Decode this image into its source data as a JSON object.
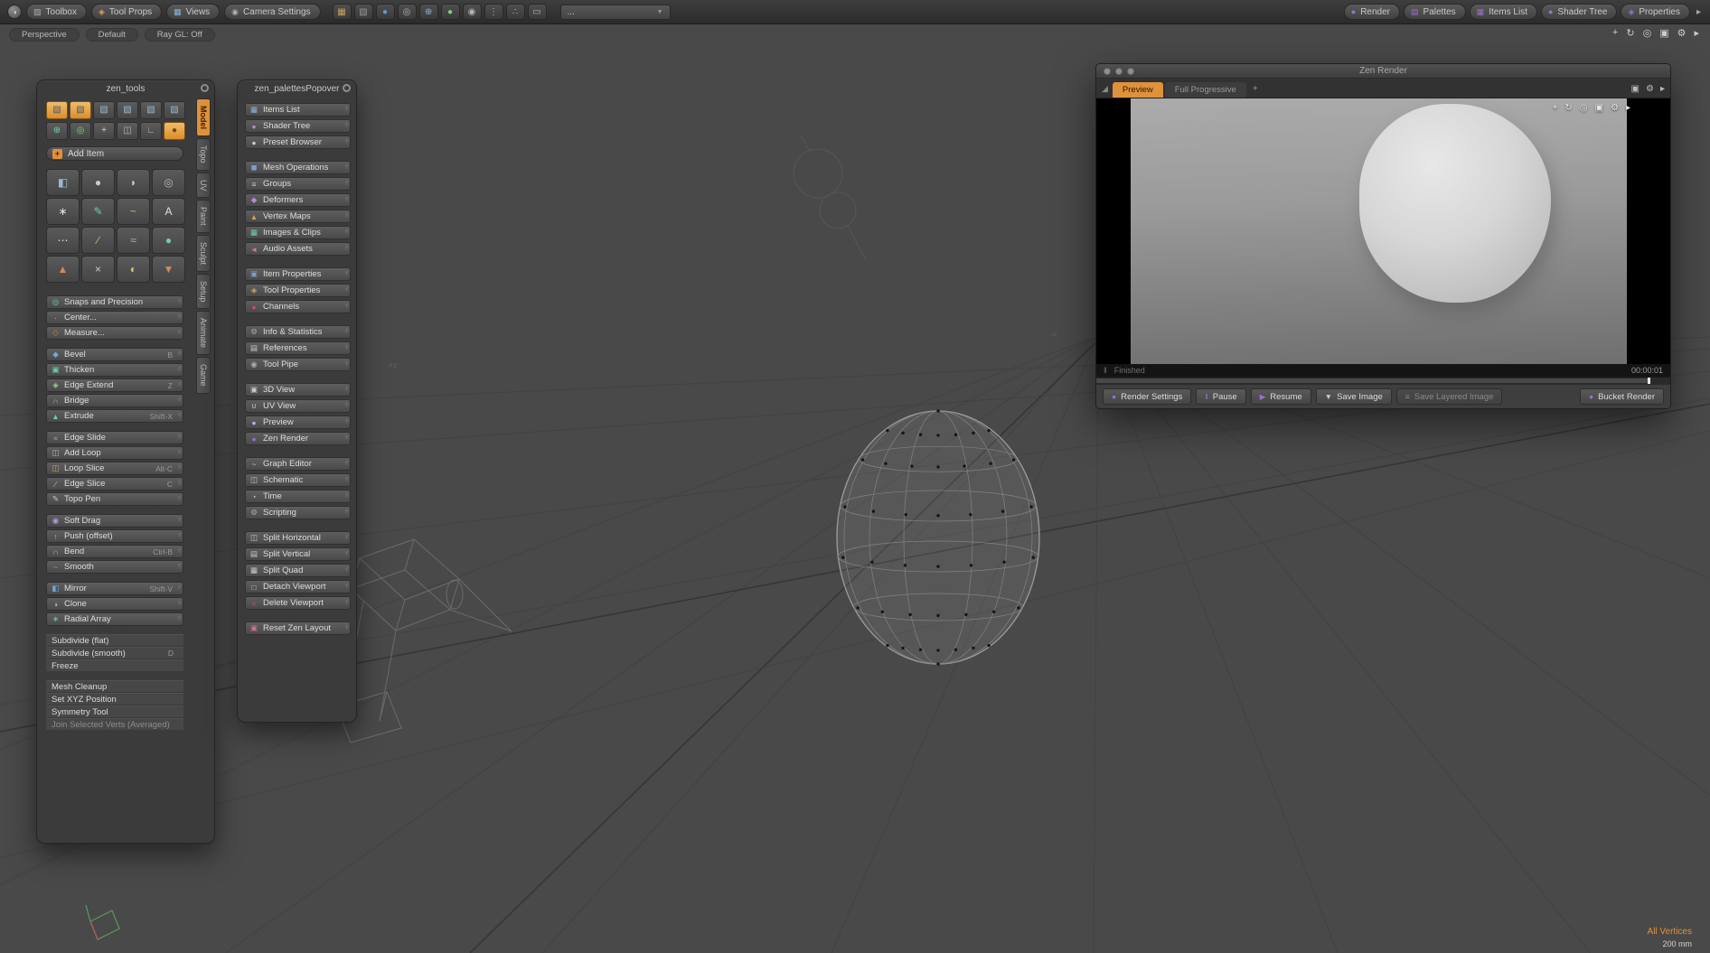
{
  "colors": {
    "accent_orange": "#e0913c",
    "accent_purple": "#9a6fd0"
  },
  "top_toolbar": {
    "left_buttons": [
      {
        "label": "Toolbox",
        "icon": "toolbox-icon",
        "glyph": "▨",
        "icon_color": "#b0b0b0"
      },
      {
        "label": "Tool Props",
        "icon": "tool-props-icon",
        "glyph": "◈",
        "icon_color": "#d4a15a"
      },
      {
        "label": "Views",
        "icon": "views-icon",
        "glyph": "▦",
        "icon_color": "#8ab4d8"
      },
      {
        "label": "Camera Settings",
        "icon": "camera-settings-icon",
        "glyph": "◉",
        "icon_color": "#b0b0b0"
      }
    ],
    "icon_cluster": [
      {
        "icon": "selection-presets-icon",
        "glyph": "▦",
        "icon_color": "#c9a15a"
      },
      {
        "icon": "workplane-icon",
        "glyph": "▧",
        "icon_color": "#9a9a9a"
      },
      {
        "icon": "snapping-icon",
        "glyph": "●",
        "icon_color": "#5a9ad4"
      },
      {
        "icon": "falloff-icon",
        "glyph": "◎",
        "icon_color": "#b8b8b8"
      },
      {
        "icon": "action-center-icon",
        "glyph": "⊕",
        "icon_color": "#8ab4d8"
      },
      {
        "icon": "symmetry-icon",
        "glyph": "●",
        "icon_color": "#7ad47a"
      },
      {
        "icon": "tool-handles-icon",
        "glyph": "◉",
        "icon_color": "#b8b8b8"
      },
      {
        "icon": "item-tree-icon",
        "glyph": "⋮",
        "icon_color": "#8fd47a"
      },
      {
        "icon": "schematic-nodes-icon",
        "glyph": "∴",
        "icon_color": "#b8b8b8"
      },
      {
        "icon": "slider-ribbon-icon",
        "glyph": "▭",
        "icon_color": "#b8b8b8"
      }
    ],
    "dropdown_value": "...",
    "dropdown_arrow": "▼",
    "right_buttons": [
      {
        "label": "Render",
        "icon": "render-icon",
        "glyph": "●",
        "icon_color": "#9a6fd0"
      },
      {
        "label": "Palettes",
        "icon": "palettes-icon",
        "glyph": "▤",
        "icon_color": "#9a6fd0"
      },
      {
        "label": "Items List",
        "icon": "items-list-icon",
        "glyph": "▦",
        "icon_color": "#9a6fd0"
      },
      {
        "label": "Shader Tree",
        "icon": "shader-tree-icon",
        "glyph": "●",
        "icon_color": "#9a6fd0"
      },
      {
        "label": "Properties",
        "icon": "properties-icon",
        "glyph": "◈",
        "icon_color": "#9a6fd0"
      }
    ],
    "expand_arrow": "▸"
  },
  "view_bar": {
    "pills": [
      {
        "label": "Perspective",
        "name": "view-type-button"
      },
      {
        "label": "Default",
        "name": "view-style-button"
      },
      {
        "label": "Ray GL: Off",
        "name": "ray-gl-button"
      }
    ],
    "icons": [
      {
        "icon": "pan-view-icon",
        "glyph": "+"
      },
      {
        "icon": "orbit-view-icon",
        "glyph": "↻"
      },
      {
        "icon": "zoom-view-icon",
        "glyph": "◎"
      },
      {
        "icon": "fit-view-icon",
        "glyph": "▣"
      },
      {
        "icon": "viewport-options-icon",
        "glyph": "⚙"
      },
      {
        "icon": "viewport-expand-icon",
        "glyph": "▸"
      }
    ]
  },
  "zen_tools": {
    "title": "zen_tools",
    "add_item_label": "Add Item",
    "mode_buttons_top": [
      {
        "icon": "vertices-mode-icon",
        "glyph": "▧",
        "icon_color": "#41586e",
        "cls": "active"
      },
      {
        "icon": "edges-mode-icon",
        "glyph": "▧",
        "icon_color": "#41586e",
        "cls": "active"
      },
      {
        "icon": "polygons-mode-icon",
        "glyph": "▧",
        "icon_color": "#9ab8d0"
      },
      {
        "icon": "items-mode-icon",
        "glyph": "▧",
        "icon_color": "#9ab8d0"
      },
      {
        "icon": "center-mode-icon",
        "glyph": "▧",
        "icon_color": "#9ab8d0"
      },
      {
        "icon": "pivot-mode-icon",
        "glyph": "▧",
        "icon_color": "#9ab8d0"
      }
    ],
    "mode_buttons_bottom": [
      {
        "icon": "axis-mode-icon",
        "glyph": "⊕",
        "icon_color": "#6ec9b8"
      },
      {
        "icon": "radial-falloff-icon",
        "glyph": "◎",
        "icon_color": "#7ad47a"
      },
      {
        "icon": "add-mode-icon",
        "glyph": "+",
        "icon_color": "#d0d0d0"
      },
      {
        "icon": "split-view-icon",
        "glyph": "◫",
        "icon_color": "#b8b8b8"
      },
      {
        "icon": "corner-align-icon",
        "glyph": "∟",
        "icon_color": "#b8b8b8"
      },
      {
        "icon": "ghost-mode-icon",
        "glyph": "●",
        "icon_color": "#6a4a10",
        "cls": "active"
      }
    ],
    "tabs": [
      {
        "label": "Model",
        "cls": "active"
      },
      {
        "label": "Topo"
      },
      {
        "label": "UV"
      },
      {
        "label": "Paint"
      },
      {
        "label": "Sculpt"
      },
      {
        "label": "Setup"
      },
      {
        "label": "Animate"
      },
      {
        "label": "Game"
      }
    ],
    "tool_grid": [
      {
        "icon": "cube-tool-icon",
        "glyph": "◧",
        "icon_color": "#9ab8d0"
      },
      {
        "icon": "sphere-tool-icon",
        "glyph": "●",
        "icon_color": "#c9c9c9"
      },
      {
        "icon": "capsule-tool-icon",
        "glyph": "◗",
        "icon_color": "#c9c9c9"
      },
      {
        "icon": "toroid-tool-icon",
        "glyph": "◎",
        "icon_color": "#b8b8b8"
      },
      {
        "icon": "star-tool-icon",
        "glyph": "∗",
        "icon_color": "#e0e0e0"
      },
      {
        "icon": "pen-tool-icon",
        "glyph": "✎",
        "icon_color": "#6ec9b8"
      },
      {
        "icon": "curve-tool-icon",
        "glyph": "~",
        "icon_color": "#8fd47a"
      },
      {
        "icon": "text-tool-icon",
        "glyph": "A",
        "icon_color": "#e0e0e0"
      },
      {
        "icon": "bezier-tool-icon",
        "glyph": "⋯",
        "icon_color": "#e0e0e0"
      },
      {
        "icon": "line-tool-icon",
        "glyph": "∕",
        "icon_color": "#8fd47a"
      },
      {
        "icon": "sketch-tool-icon",
        "glyph": "≈",
        "icon_color": "#8fd47a"
      },
      {
        "icon": "blob-tool-icon",
        "glyph": "●",
        "icon_color": "#6ec9b8"
      },
      {
        "icon": "cone-tool-icon",
        "glyph": "▲",
        "icon_color": "#d4885a"
      },
      {
        "icon": "axis-drill-tool-icon",
        "glyph": "×",
        "icon_color": "#c9c9c9"
      },
      {
        "icon": "uv-sphere-tool-icon",
        "glyph": "◐",
        "icon_color": "#e0c97a"
      },
      {
        "icon": "paint-tool-icon",
        "glyph": "▼",
        "icon_color": "#d4885a"
      }
    ],
    "buttons": [
      {
        "label": "Snaps and Precision",
        "shortcut": "",
        "icon": "snaps-icon",
        "glyph": "◎",
        "icon_color": "#6ec9b8"
      },
      {
        "label": "Center...",
        "shortcut": "",
        "icon": "center-icon",
        "glyph": "·",
        "icon_color": "#cccccc"
      },
      {
        "label": "Measure...",
        "shortcut": "",
        "icon": "measure-icon",
        "glyph": "◇",
        "icon_color": "#d4885a"
      },
      {
        "label": "Bevel",
        "shortcut": "B",
        "icon": "bevel-icon",
        "glyph": "◆",
        "icon_color": "#6fa8dc",
        "cls": "gap"
      },
      {
        "label": "Thicken",
        "shortcut": "",
        "icon": "thicken-icon",
        "glyph": "▣",
        "icon_color": "#6fc9a8"
      },
      {
        "label": "Edge Extend",
        "shortcut": "Z",
        "icon": "edge-extend-icon",
        "glyph": "◈",
        "icon_color": "#8fd47a"
      },
      {
        "label": "Bridge",
        "shortcut": "",
        "icon": "bridge-icon",
        "glyph": "∩",
        "icon_color": "#8fd47a"
      },
      {
        "label": "Extrude",
        "shortcut": "Shift-X",
        "icon": "extrude-icon",
        "glyph": "▲",
        "icon_color": "#6ec9b8"
      },
      {
        "label": "Edge Slide",
        "shortcut": "",
        "icon": "edge-slide-icon",
        "glyph": "≈",
        "icon_color": "#b8b8b8",
        "cls": "gap"
      },
      {
        "label": "Add Loop",
        "shortcut": "",
        "icon": "add-loop-icon",
        "glyph": "◫",
        "icon_color": "#b8b8b8"
      },
      {
        "label": "Loop Slice",
        "shortcut": "Alt-C",
        "icon": "loop-slice-icon",
        "glyph": "◫",
        "icon_color": "#d4a15a"
      },
      {
        "label": "Edge Slice",
        "shortcut": "C",
        "icon": "edge-slice-icon",
        "glyph": "∕",
        "icon_color": "#b8b8b8"
      },
      {
        "label": "Topo Pen",
        "shortcut": "",
        "icon": "topo-pen-icon",
        "glyph": "✎",
        "icon_color": "#c9c9c9"
      },
      {
        "label": "Soft Drag",
        "shortcut": "",
        "icon": "soft-drag-icon",
        "glyph": "◉",
        "icon_color": "#b79ad6",
        "cls": "gap"
      },
      {
        "label": "Push (offset)",
        "shortcut": "",
        "icon": "push-icon",
        "glyph": "↑",
        "icon_color": "#b8b8b8"
      },
      {
        "label": "Bend",
        "shortcut": "Ctrl-B",
        "icon": "bend-icon",
        "glyph": "∩",
        "icon_color": "#8fd47a"
      },
      {
        "label": "Smooth",
        "shortcut": "",
        "icon": "smooth-icon",
        "glyph": "~",
        "icon_color": "#c9a176"
      },
      {
        "label": "Mirror",
        "shortcut": "Shift-V",
        "icon": "mirror-icon",
        "glyph": "◧",
        "icon_color": "#6fa8dc",
        "cls": "gap"
      },
      {
        "label": "Clone",
        "shortcut": "",
        "icon": "clone-icon",
        "glyph": "◑",
        "icon_color": "#b8b8b8"
      },
      {
        "label": "Radial Array",
        "shortcut": "",
        "icon": "radial-array-icon",
        "glyph": "∗",
        "icon_color": "#6ec9b8"
      },
      {
        "label": "Subdivide (flat)",
        "shortcut": "",
        "cls": "gap flat"
      },
      {
        "label": "Subdivide (smooth)",
        "shortcut": "D",
        "cls": "flat"
      },
      {
        "label": "Freeze",
        "shortcut": "",
        "cls": "flat"
      },
      {
        "label": "Mesh Cleanup",
        "shortcut": "",
        "cls": "gap flat"
      },
      {
        "label": "Set XYZ Position",
        "shortcut": "",
        "cls": "flat"
      },
      {
        "label": "Symmetry Tool",
        "shortcut": "",
        "cls": "flat"
      },
      {
        "label": "Join Selected Verts (Averaged)",
        "shortcut": "",
        "cls": "flat disabled"
      }
    ]
  },
  "zen_palettes": {
    "title": "zen_palettesPopover",
    "items": [
      {
        "label": "Items List",
        "icon": "items-list-icon",
        "glyph": "▦",
        "icon_color": "#8ab4d8"
      },
      {
        "label": "Shader Tree",
        "icon": "shader-tree-icon",
        "glyph": "●",
        "icon_color": "#b08ad8"
      },
      {
        "label": "Preset Browser",
        "icon": "preset-browser-icon",
        "glyph": "●",
        "icon_color": "#c9c9c9"
      },
      {
        "label": "Mesh Operations",
        "icon": "mesh-operations-icon",
        "glyph": "◼",
        "icon_color": "#7a9fd4",
        "cls": "gap"
      },
      {
        "label": "Groups",
        "icon": "groups-icon",
        "glyph": "≡",
        "icon_color": "#c9c9c9"
      },
      {
        "label": "Deformers",
        "icon": "deformers-icon",
        "glyph": "◆",
        "icon_color": "#b08ad8"
      },
      {
        "label": "Vertex Maps",
        "icon": "vertex-maps-icon",
        "glyph": "▲",
        "icon_color": "#d4a15a"
      },
      {
        "label": "Images & Clips",
        "icon": "images-clips-icon",
        "glyph": "▦",
        "icon_color": "#6ec9b8"
      },
      {
        "label": "Audio Assets",
        "icon": "audio-assets-icon",
        "glyph": "◄",
        "icon_color": "#d47a7a"
      },
      {
        "label": "Item Properties",
        "icon": "item-properties-icon",
        "glyph": "▣",
        "icon_color": "#7a9fd4",
        "cls": "gap"
      },
      {
        "label": "Tool Properties",
        "icon": "tool-properties-icon",
        "glyph": "◈",
        "icon_color": "#d4a15a"
      },
      {
        "label": "Channels",
        "icon": "channels-icon",
        "glyph": "●",
        "icon_color": "#d44a6a"
      },
      {
        "label": "Info & Statistics",
        "icon": "info-statistics-icon",
        "glyph": "⚙",
        "icon_color": "#aaaaaa",
        "cls": "gap"
      },
      {
        "label": "References",
        "icon": "references-icon",
        "glyph": "▤",
        "icon_color": "#c9c9c9"
      },
      {
        "label": "Tool Pipe",
        "icon": "tool-pipe-icon",
        "glyph": "◉",
        "icon_color": "#aaaaaa"
      },
      {
        "label": "3D View",
        "icon": "3d-view-icon",
        "glyph": "▣",
        "icon_color": "#c9c9c9",
        "cls": "gap"
      },
      {
        "label": "UV View",
        "icon": "uv-view-icon",
        "glyph": "∪",
        "icon_color": "#c9c9c9"
      },
      {
        "label": "Preview",
        "icon": "preview-icon",
        "glyph": "●",
        "icon_color": "#caa8e0"
      },
      {
        "label": "Zen Render",
        "icon": "zen-render-icon",
        "glyph": "●",
        "icon_color": "#9a6fd0"
      },
      {
        "label": "Graph Editor",
        "icon": "graph-editor-icon",
        "glyph": "~",
        "icon_color": "#c9c9c9",
        "cls": "gap"
      },
      {
        "label": "Schematic",
        "icon": "schematic-icon",
        "glyph": "◫",
        "icon_color": "#c9c9c9"
      },
      {
        "label": "Time",
        "icon": "time-icon",
        "glyph": "◔",
        "icon_color": "#c9c9c9"
      },
      {
        "label": "Scripting",
        "icon": "scripting-icon",
        "glyph": "⚙",
        "icon_color": "#aaaaaa"
      },
      {
        "label": "Split Horizontal",
        "icon": "split-horizontal-icon",
        "glyph": "◫",
        "icon_color": "#c9c9c9",
        "cls": "gap"
      },
      {
        "label": "Split Vertical",
        "icon": "split-vertical-icon",
        "glyph": "▤",
        "icon_color": "#c9c9c9"
      },
      {
        "label": "Split Quad",
        "icon": "split-quad-icon",
        "glyph": "▦",
        "icon_color": "#c9c9c9"
      },
      {
        "label": "Detach Viewport",
        "icon": "detach-viewport-icon",
        "glyph": "□",
        "icon_color": "#c9c9c9"
      },
      {
        "label": "Delete Viewport",
        "icon": "delete-viewport-icon",
        "glyph": "×",
        "icon_color": "#d44a6a"
      },
      {
        "label": "Reset Zen Layout",
        "icon": "reset-zen-layout-icon",
        "glyph": "▣",
        "icon_color": "#d46a9a",
        "cls": "gap"
      }
    ]
  },
  "zen_render": {
    "title": "Zen Render",
    "tabs": [
      {
        "label": "Preview",
        "cls": "active"
      },
      {
        "label": "Full Progressive"
      }
    ],
    "add_tab_label": "+",
    "status": "Finished",
    "elapsed": "00:00:01",
    "buttons": [
      {
        "label": "Render Settings",
        "icon": "render-settings-icon",
        "glyph": "●",
        "icon_color": "#9a6fd0"
      },
      {
        "label": "Pause",
        "icon": "pause-icon",
        "glyph": "‖",
        "icon_color": "#9a6fd0"
      },
      {
        "label": "Resume",
        "icon": "resume-icon",
        "glyph": "▶",
        "icon_color": "#9a6fd0"
      },
      {
        "label": "Save Image",
        "icon": "save-image-icon",
        "glyph": "▼",
        "icon_color": "#c9c9c9"
      },
      {
        "label": "Save Layered Image",
        "icon": "save-layered-image-icon",
        "glyph": "≡",
        "icon_color": "#8a8a8a",
        "cls": "disabled"
      },
      {
        "label": "Bucket Render",
        "icon": "bucket-render-icon",
        "glyph": "●",
        "icon_color": "#9a6fd0",
        "cls": "right"
      }
    ]
  },
  "viewport": {
    "axis_z": "+z",
    "axis_x": "-x",
    "status_primary": "All Vertices",
    "status_secondary": "200 mm"
  }
}
